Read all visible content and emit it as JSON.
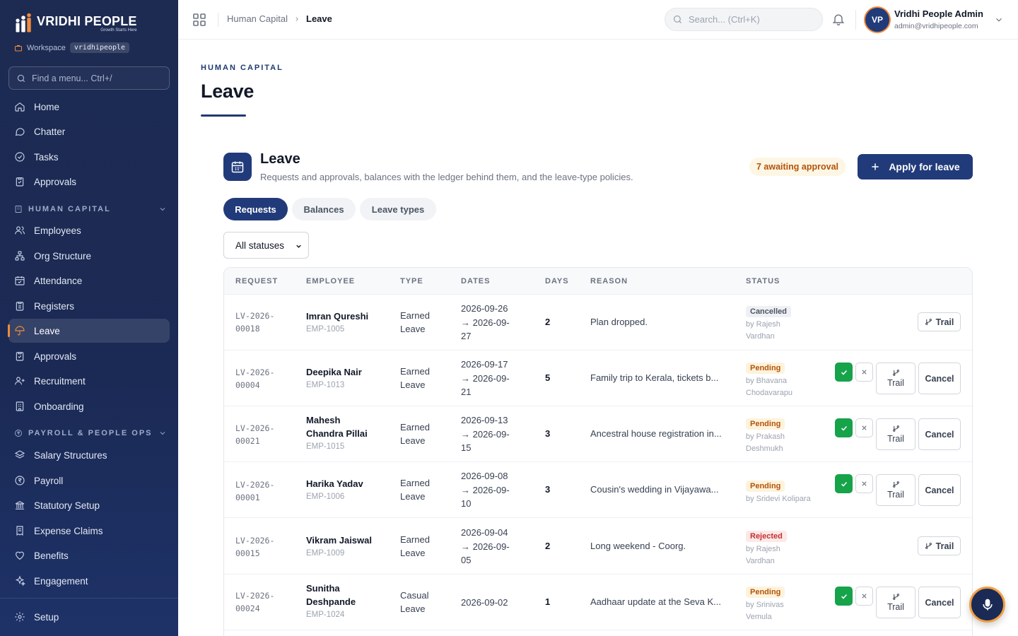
{
  "brand": {
    "name": "VRIDHI PEOPLE",
    "tagline": "Growth Starts Here"
  },
  "workspace": {
    "label": "Workspace",
    "value": "vridhipeople"
  },
  "sidebar": {
    "search_placeholder": "Find a menu... Ctrl+/",
    "items_top": [
      {
        "label": "Home",
        "icon": "home-icon"
      },
      {
        "label": "Chatter",
        "icon": "chat-icon"
      },
      {
        "label": "Tasks",
        "icon": "check-circle-icon"
      },
      {
        "label": "Approvals",
        "icon": "clipboard-icon"
      }
    ],
    "section_hc": "HUMAN CAPITAL",
    "items_hc": [
      {
        "label": "Employees",
        "icon": "users-icon"
      },
      {
        "label": "Org Structure",
        "icon": "org-icon"
      },
      {
        "label": "Attendance",
        "icon": "calendar-check-icon"
      },
      {
        "label": "Registers",
        "icon": "clipboard-list-icon"
      },
      {
        "label": "Leave",
        "icon": "umbrella-icon",
        "active": true
      },
      {
        "label": "Approvals",
        "icon": "clipboard-check-icon"
      },
      {
        "label": "Recruitment",
        "icon": "user-plus-icon"
      },
      {
        "label": "Onboarding",
        "icon": "building-icon"
      }
    ],
    "section_pay": "PAYROLL & PEOPLE OPS",
    "items_pay": [
      {
        "label": "Salary Structures",
        "icon": "layers-icon"
      },
      {
        "label": "Payroll",
        "icon": "rupee-circle-icon"
      },
      {
        "label": "Statutory Setup",
        "icon": "landmark-icon"
      },
      {
        "label": "Expense Claims",
        "icon": "receipt-icon"
      },
      {
        "label": "Benefits",
        "icon": "heart-handshake-icon"
      },
      {
        "label": "Engagement",
        "icon": "sparkles-icon"
      }
    ],
    "setup": "Setup"
  },
  "topbar": {
    "breadcrumb": [
      "Human Capital",
      "Leave"
    ],
    "search_placeholder": "Search... (Ctrl+K)",
    "user": {
      "initials": "VP",
      "name": "Vridhi People Admin",
      "email": "admin@vridhipeople.com"
    }
  },
  "page": {
    "eyebrow": "HUMAN CAPITAL",
    "title": "Leave"
  },
  "card": {
    "title": "Leave",
    "subtitle": "Requests and approvals, balances with the ledger behind them, and the leave-type policies.",
    "awaiting": "7 awaiting approval",
    "apply_label": "Apply for leave",
    "tabs": [
      "Requests",
      "Balances",
      "Leave types"
    ],
    "filter_value": "All statuses"
  },
  "table": {
    "headers": [
      "REQUEST",
      "EMPLOYEE",
      "TYPE",
      "DATES",
      "DAYS",
      "REASON",
      "STATUS"
    ],
    "rows": [
      {
        "req1": "LV-2026-",
        "req2": "00018",
        "name": "Imran Qureshi",
        "id": "EMP-1005",
        "type1": "Earned",
        "type2": "Leave",
        "d1": "2026-09-26",
        "d2": "→ 2026-09-",
        "d3": "27",
        "days": "2",
        "reason": "Plan dropped.",
        "status": "Cancelled",
        "by1": "by Rajesh",
        "by2": "Vardhan",
        "actions": "trail"
      },
      {
        "req1": "LV-2026-",
        "req2": "00004",
        "name": "Deepika Nair",
        "id": "EMP-1013",
        "type1": "Earned",
        "type2": "Leave",
        "d1": "2026-09-17",
        "d2": "→ 2026-09-",
        "d3": "21",
        "days": "5",
        "reason": "Family trip to Kerala, tickets b...",
        "status": "Pending",
        "by1": "by Bhavana",
        "by2": "Chodavarapu",
        "actions": "full"
      },
      {
        "req1": "LV-2026-",
        "req2": "00021",
        "name": "Mahesh Chandra Pillai",
        "id": "EMP-1015",
        "type1": "Earned",
        "type2": "Leave",
        "d1": "2026-09-13",
        "d2": "→ 2026-09-",
        "d3": "15",
        "days": "3",
        "reason": "Ancestral house registration in...",
        "status": "Pending",
        "by1": "by Prakash",
        "by2": "Deshmukh",
        "actions": "full"
      },
      {
        "req1": "LV-2026-",
        "req2": "00001",
        "name": "Harika Yadav",
        "id": "EMP-1006",
        "type1": "Earned",
        "type2": "Leave",
        "d1": "2026-09-08",
        "d2": "→ 2026-09-",
        "d3": "10",
        "days": "3",
        "reason": "Cousin's wedding in Vijayawa...",
        "status": "Pending",
        "by1": "by Sridevi Kolipara",
        "by2": "",
        "actions": "full"
      },
      {
        "req1": "LV-2026-",
        "req2": "00015",
        "name": "Vikram Jaiswal",
        "id": "EMP-1009",
        "type1": "Earned",
        "type2": "Leave",
        "d1": "2026-09-04",
        "d2": "→ 2026-09-",
        "d3": "05",
        "days": "2",
        "reason": "Long weekend - Coorg.",
        "status": "Rejected",
        "by1": "by Rajesh",
        "by2": "Vardhan",
        "actions": "trail"
      },
      {
        "req1": "LV-2026-",
        "req2": "00024",
        "name": "Sunitha Deshpande",
        "id": "EMP-1024",
        "type1": "Casual",
        "type2": "Leave",
        "d1": "2026-09-02",
        "d2": "",
        "d3": "",
        "days": "1",
        "reason": "Aadhaar update at the Seva K...",
        "status": "Pending",
        "by1": "by Srinivas",
        "by2": "Vemula",
        "actions": "full"
      }
    ],
    "trail_label": "Trail",
    "cancel_label": "Cancel"
  },
  "colors": {
    "brand_navy": "#213b7a",
    "accent_orange": "#f08a3c",
    "approve_green": "#16a34a"
  }
}
